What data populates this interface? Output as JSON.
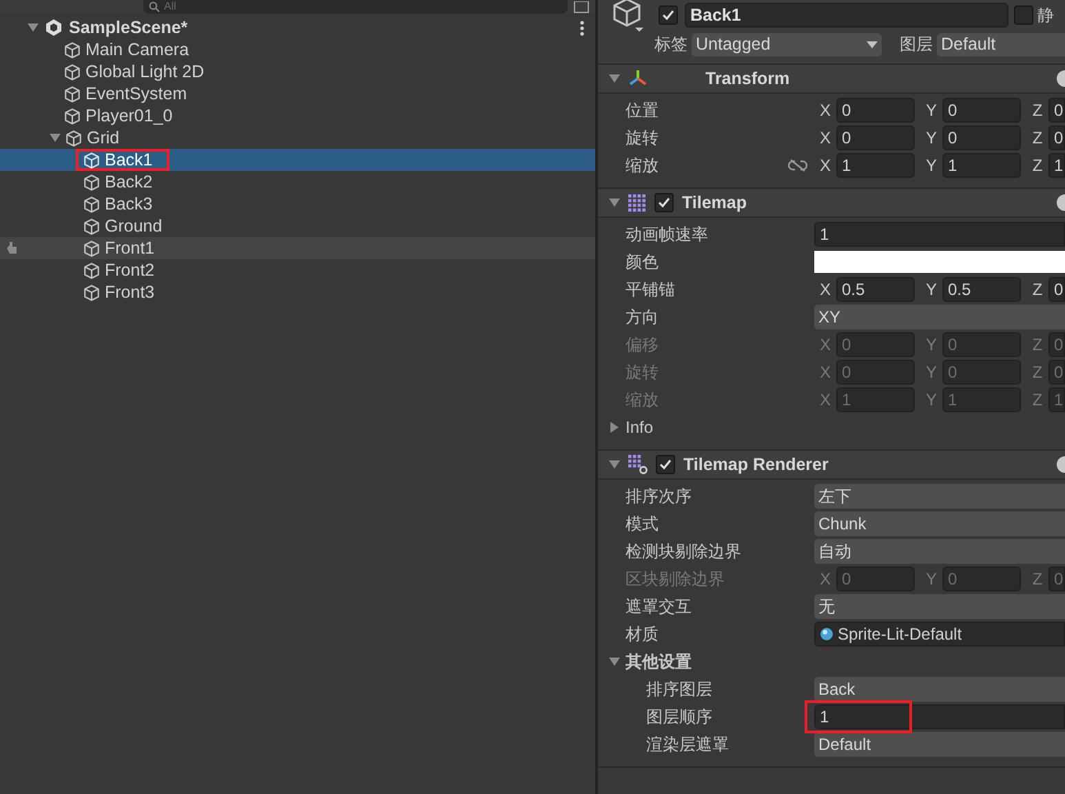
{
  "hierarchy": {
    "search": {
      "placeholder": "All"
    },
    "scene": {
      "name": "SampleScene*",
      "expanded": true
    },
    "items": [
      {
        "name": "Main Camera",
        "selected": false,
        "hovered": false,
        "highlighted": false
      },
      {
        "name": "Global Light 2D",
        "selected": false,
        "hovered": false,
        "highlighted": false
      },
      {
        "name": "EventSystem",
        "selected": false,
        "hovered": false,
        "highlighted": false
      },
      {
        "name": "Player01_0",
        "selected": false,
        "hovered": false,
        "highlighted": false
      },
      {
        "name": "Grid",
        "selected": false,
        "hovered": false,
        "highlighted": false,
        "expanded": true,
        "children": [
          {
            "name": "Back1",
            "selected": true,
            "hovered": false,
            "highlighted": true
          },
          {
            "name": "Back2",
            "selected": false,
            "hovered": false,
            "highlighted": false
          },
          {
            "name": "Back3",
            "selected": false,
            "hovered": false,
            "highlighted": false
          },
          {
            "name": "Ground",
            "selected": false,
            "hovered": false,
            "highlighted": false
          },
          {
            "name": "Front1",
            "selected": false,
            "hovered": true,
            "highlighted": false
          },
          {
            "name": "Front2",
            "selected": false,
            "hovered": false,
            "highlighted": false
          },
          {
            "name": "Front3",
            "selected": false,
            "hovered": false,
            "highlighted": false
          }
        ]
      }
    ]
  },
  "inspector": {
    "object": {
      "name": "Back1",
      "active": true,
      "static_label": "静",
      "static": false,
      "tag_label": "标签",
      "tag": "Untagged",
      "layer_label": "图层",
      "layer": "Default"
    },
    "components": [
      {
        "title": "Transform",
        "expanded": true,
        "rows": [
          {
            "kind": "vector",
            "label": "位置",
            "disabled": false,
            "link": false,
            "axes": [
              {
                "axis": "X",
                "value": "0"
              },
              {
                "axis": "Y",
                "value": "0"
              },
              {
                "axis": "Z",
                "value": "0"
              }
            ]
          },
          {
            "kind": "vector",
            "label": "旋转",
            "disabled": false,
            "link": false,
            "axes": [
              {
                "axis": "X",
                "value": "0"
              },
              {
                "axis": "Y",
                "value": "0"
              },
              {
                "axis": "Z",
                "value": "0"
              }
            ]
          },
          {
            "kind": "vector",
            "label": "缩放",
            "disabled": false,
            "link": true,
            "axes": [
              {
                "axis": "X",
                "value": "1"
              },
              {
                "axis": "Y",
                "value": "1"
              },
              {
                "axis": "Z",
                "value": "1"
              }
            ]
          }
        ]
      },
      {
        "title": "Tilemap",
        "enabled": true,
        "expanded": true,
        "rows": [
          {
            "kind": "field",
            "label": "动画帧速率",
            "value": "1",
            "disabled": false,
            "highlighted": false
          },
          {
            "kind": "color",
            "label": "颜色",
            "color": "#ffffff",
            "disabled": false
          },
          {
            "kind": "vector",
            "label": "平铺锚",
            "disabled": false,
            "link": false,
            "axes": [
              {
                "axis": "X",
                "value": "0.5"
              },
              {
                "axis": "Y",
                "value": "0.5"
              },
              {
                "axis": "Z",
                "value": "0"
              }
            ]
          },
          {
            "kind": "dropdown",
            "label": "方向",
            "value": "XY",
            "disabled": false
          },
          {
            "kind": "vector",
            "label": "偏移",
            "disabled": true,
            "link": false,
            "axes": [
              {
                "axis": "X",
                "value": "0"
              },
              {
                "axis": "Y",
                "value": "0"
              },
              {
                "axis": "Z",
                "value": "0"
              }
            ]
          },
          {
            "kind": "vector",
            "label": "旋转",
            "disabled": true,
            "link": false,
            "axes": [
              {
                "axis": "X",
                "value": "0"
              },
              {
                "axis": "Y",
                "value": "0"
              },
              {
                "axis": "Z",
                "value": "0"
              }
            ]
          },
          {
            "kind": "vector",
            "label": "缩放",
            "disabled": true,
            "link": false,
            "axes": [
              {
                "axis": "X",
                "value": "1"
              },
              {
                "axis": "Y",
                "value": "1"
              },
              {
                "axis": "Z",
                "value": "1"
              }
            ]
          },
          {
            "kind": "foldout",
            "label": "Info",
            "expanded": false,
            "children": []
          }
        ]
      },
      {
        "title": "Tilemap Renderer",
        "enabled": true,
        "expanded": true,
        "rows": [
          {
            "kind": "dropdown",
            "label": "排序次序",
            "value": "左下",
            "disabled": false
          },
          {
            "kind": "dropdown",
            "label": "模式",
            "value": "Chunk",
            "disabled": false
          },
          {
            "kind": "dropdown",
            "label": "检测块剔除边界",
            "value": "自动",
            "disabled": false
          },
          {
            "kind": "vector",
            "label": "区块剔除边界",
            "disabled": true,
            "link": false,
            "axes": [
              {
                "axis": "X",
                "value": "0"
              },
              {
                "axis": "Y",
                "value": "0"
              },
              {
                "axis": "Z",
                "value": "0"
              }
            ]
          },
          {
            "kind": "dropdown",
            "label": "遮罩交互",
            "value": "无",
            "disabled": false
          },
          {
            "kind": "object",
            "label": "材质",
            "value": "Sprite-Lit-Default",
            "disabled": false
          },
          {
            "kind": "foldout",
            "label": "其他设置",
            "expanded": true,
            "children": [
              {
                "kind": "dropdown",
                "label": "排序图层",
                "value": "Back",
                "disabled": false
              },
              {
                "kind": "field",
                "label": "图层顺序",
                "value": "1",
                "disabled": false,
                "highlighted": true
              },
              {
                "kind": "dropdown",
                "label": "渲染层遮罩",
                "value": "Default",
                "disabled": false
              }
            ]
          }
        ]
      }
    ]
  }
}
